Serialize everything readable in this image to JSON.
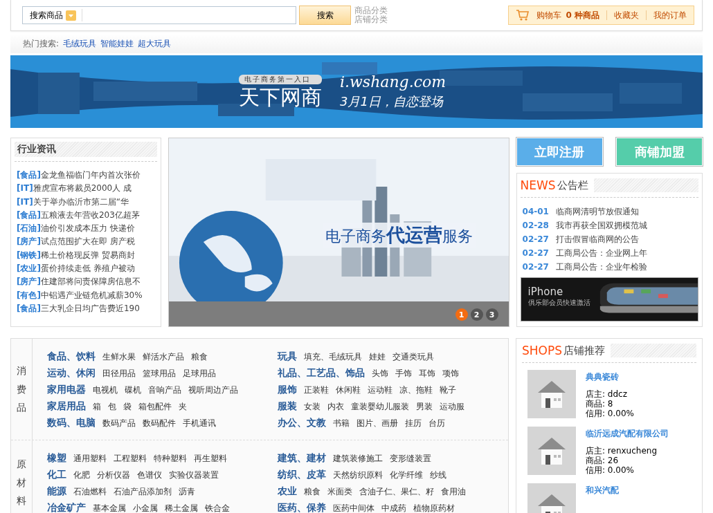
{
  "search": {
    "category": "搜索商品",
    "button": "搜索",
    "links": [
      "商品分类",
      "店铺分类"
    ]
  },
  "cart": {
    "label": "购物车",
    "count": "0 种商品",
    "links": [
      "收藏夹",
      "我的订单"
    ]
  },
  "hot_search": {
    "label": "热门搜索:",
    "items": [
      "毛绒玩具",
      "智能娃娃",
      "超大玩具"
    ]
  },
  "banner": {
    "tagline": "电子商务第一入口",
    "brand": "天下网商",
    "url": "i.wshang.com",
    "slogan": "3月1日，自恋登场"
  },
  "industry_news": {
    "title": "行业资讯",
    "items": [
      {
        "tag": "[食品]",
        "text": "金龙鱼福临门年内首次张价"
      },
      {
        "tag": "[IT]",
        "text": "雅虎宣布将裁员2000人 成"
      },
      {
        "tag": "[IT]",
        "text": "关于举办临沂市第二届“华"
      },
      {
        "tag": "[食品]",
        "text": "五粮液去年营收203亿超茅"
      },
      {
        "tag": "[石油]",
        "text": "油价引发成本压力 快递价"
      },
      {
        "tag": "[房产]",
        "text": "试点范围扩大在即 房产税"
      },
      {
        "tag": "[钢铁]",
        "text": "稀土价格现反弹 贸易商封"
      },
      {
        "tag": "[农业]",
        "text": "蛋价持续走低 养殖户被动"
      },
      {
        "tag": "[房产]",
        "text": "住建部将问责保障房信息不"
      },
      {
        "tag": "[有色]",
        "text": "中铝遇产业链危机减薪30%"
      },
      {
        "tag": "[食品]",
        "text": "三大乳企日均广告费近190"
      }
    ]
  },
  "slider": {
    "headline": [
      "电子商务",
      "代运营",
      "服务"
    ],
    "pages": [
      {
        "label": "1",
        "selected": true
      },
      {
        "label": "2",
        "selected": false
      },
      {
        "label": "3",
        "selected": false
      }
    ]
  },
  "actions": [
    {
      "label": "立即注册",
      "color": "#5aaee9"
    },
    {
      "label": "商铺加盟",
      "color": "#55cdaa"
    }
  ],
  "notices": {
    "title_en": "NEWS",
    "title": "公告栏",
    "items": [
      {
        "date": "04-01",
        "text": "临商网清明节放假通知"
      },
      {
        "date": "02-28",
        "text": "我市再获全国双拥模范城"
      },
      {
        "date": "02-27",
        "text": "打击假冒临商网的公告"
      },
      {
        "date": "02-27",
        "text": "工商局公告：企业网上年"
      },
      {
        "date": "02-27",
        "text": "工商局公告：企业年检验"
      }
    ],
    "ad": {
      "brand": "iPhone",
      "caption": "俱乐部会员快速激活"
    }
  },
  "categories": [
    {
      "group": "消费品",
      "columns": [
        [
          {
            "name": "食品、饮料",
            "subs": [
              "生鲜水果",
              "鲜活水产品",
              "粮食"
            ]
          },
          {
            "name": "运动、休闲",
            "subs": [
              "田径用品",
              "篮球用品",
              "足球用品"
            ]
          },
          {
            "name": "家用电器",
            "subs": [
              "电视机",
              "碟机",
              "音响产品",
              "视听周边产品"
            ]
          },
          {
            "name": "家居用品",
            "subs": [
              "箱",
              "包",
              "袋",
              "箱包配件",
              "夹"
            ]
          },
          {
            "name": "数码、电脑",
            "subs": [
              "数码产品",
              "数码配件",
              "手机通讯"
            ]
          }
        ],
        [
          {
            "name": "玩具",
            "subs": [
              "填充、毛绒玩具",
              "娃娃",
              "交通类玩具"
            ]
          },
          {
            "name": "礼品、工艺品、饰品",
            "subs": [
              "头饰",
              "手饰",
              "耳饰",
              "项饰"
            ]
          },
          {
            "name": "服饰",
            "subs": [
              "正装鞋",
              "休闲鞋",
              "运动鞋",
              "凉、拖鞋",
              "靴子"
            ]
          },
          {
            "name": "服装",
            "subs": [
              "女装",
              "内衣",
              "童装婴幼儿服装",
              "男装",
              "运动服"
            ]
          },
          {
            "name": "办公、文教",
            "subs": [
              "书籍",
              "图片、画册",
              "挂历",
              "台历"
            ]
          }
        ]
      ]
    },
    {
      "group": "原材料",
      "columns": [
        [
          {
            "name": "橡塑",
            "subs": [
              "通用塑料",
              "工程塑料",
              "特种塑料",
              "再生塑料"
            ]
          },
          {
            "name": "化工",
            "subs": [
              "化肥",
              "分析仪器",
              "色谱仪",
              "实验仪器装置"
            ]
          },
          {
            "name": "能源",
            "subs": [
              "石油燃料",
              "石油产品添加剂",
              "沥青"
            ]
          },
          {
            "name": "冶金矿产",
            "subs": [
              "基本金属",
              "小金属",
              "稀土金属",
              "铁合金"
            ]
          }
        ],
        [
          {
            "name": "建筑、建材",
            "subs": [
              "建筑装修施工",
              "变形缝装置"
            ]
          },
          {
            "name": "纺织、皮革",
            "subs": [
              "天然纺织原料",
              "化学纤维",
              "纱线"
            ]
          },
          {
            "name": "农业",
            "subs": [
              "粮食",
              "米面类",
              "含油子仁、果仁、籽",
              "食用油"
            ]
          },
          {
            "name": "医药、保养",
            "subs": [
              "医药中间体",
              "中成药",
              "植物原药材"
            ]
          }
        ]
      ]
    }
  ],
  "shops": {
    "title_en": "SHOPS",
    "title": "店铺推荐",
    "items": [
      {
        "name": "典典瓷砖",
        "lines": [
          "店主: ddcz",
          "商品: 8",
          "信用: 0.00%"
        ]
      },
      {
        "name": "临沂远成汽配有限公司",
        "lines": [
          "店主: renxucheng",
          "商品: 26",
          "信用: 0.00%"
        ]
      },
      {
        "name": "和兴汽配"
      }
    ]
  }
}
